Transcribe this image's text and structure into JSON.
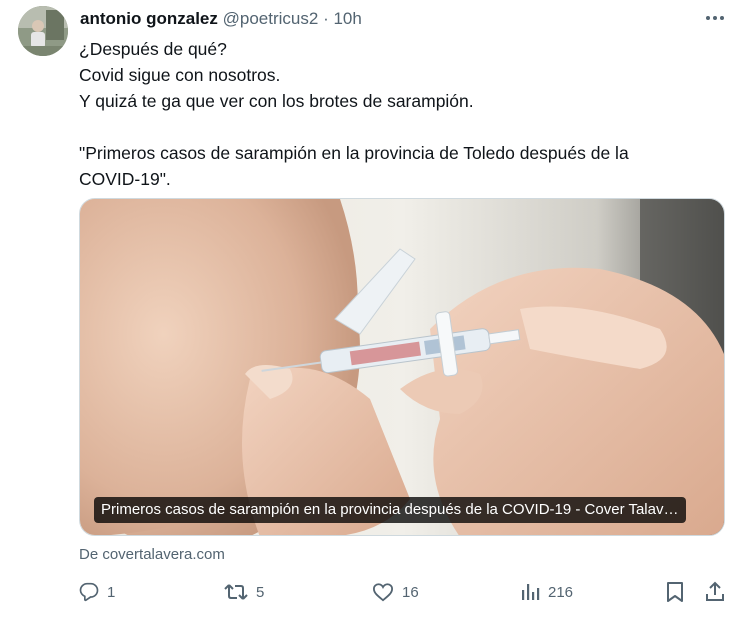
{
  "tweet": {
    "author_name": "antonio gonzalez",
    "handle": "@poetricus2",
    "separator": "·",
    "time": "10h",
    "text_lines": [
      "¿Después de qué?",
      "Covid sigue con nosotros.",
      "Y quizá te ga que ver con los brotes de sarampión.",
      "",
      "\"Primeros casos de sarampión en la provincia de Toledo después de la",
      "COVID-19\"."
    ],
    "card": {
      "caption": "Primeros casos de sarampión en la provincia después de la COVID-19 - Cover Talav…",
      "source": "De covertalavera.com"
    },
    "actions": {
      "reply_count": "1",
      "retweet_count": "5",
      "like_count": "16",
      "views_count": "216"
    }
  },
  "icons": [
    "more-icon",
    "reply-icon",
    "retweet-icon",
    "like-icon",
    "views-icon",
    "bookmark-icon",
    "share-icon"
  ],
  "colors": {
    "text": "#0f1419",
    "secondary": "#536471",
    "border": "#cfd9de"
  }
}
